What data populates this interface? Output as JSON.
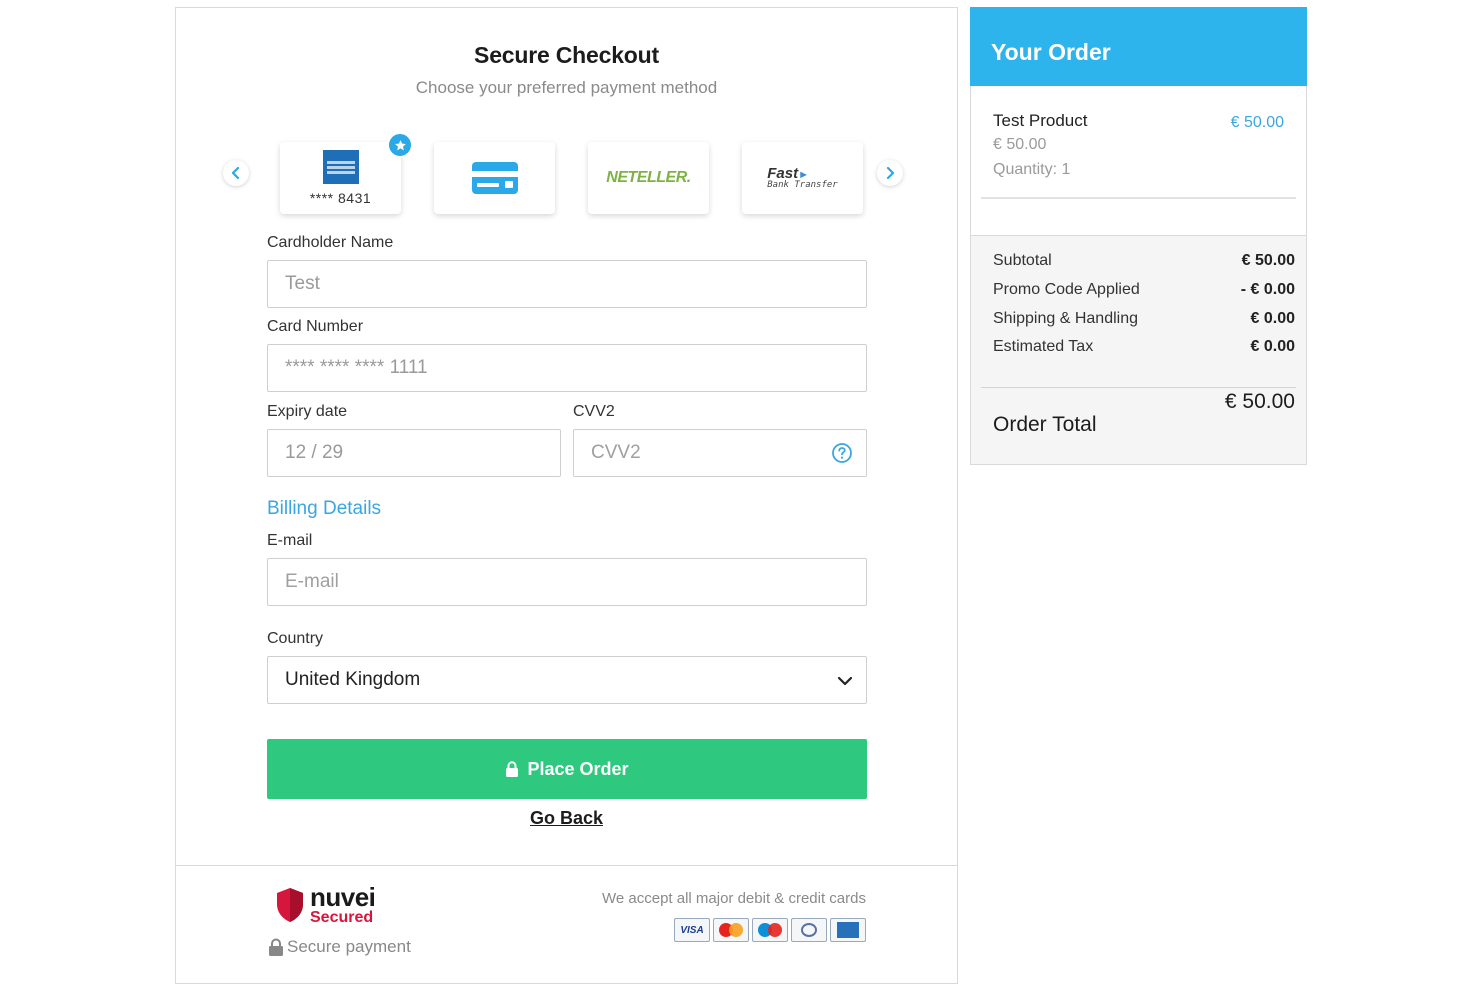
{
  "checkout": {
    "title": "Secure Checkout",
    "subtitle": "Choose your preferred payment method",
    "payment_methods": [
      {
        "name": "American Express",
        "masked": "**** 8431",
        "selected": true
      },
      {
        "name": "Credit Card"
      },
      {
        "name": "NETELLER",
        "logo_text": "NETELLER."
      },
      {
        "name": "Fast Bank Transfer",
        "logo_text": "Fast",
        "logo_subtext": "Bank Transfer"
      }
    ],
    "cardholder_label": "Cardholder Name",
    "cardholder_value": "Test",
    "card_number_label": "Card Number",
    "card_number_value": "**** **** **** 1111",
    "expiry_label": "Expiry date",
    "expiry_value": "12 / 29",
    "cvv_label": "CVV2",
    "cvv_placeholder": "CVV2",
    "billing_heading": "Billing Details",
    "email_label": "E-mail",
    "email_placeholder": "E-mail",
    "country_label": "Country",
    "country_value": "United Kingdom",
    "place_order_label": "Place Order",
    "go_back_label": "Go Back",
    "footer": {
      "brand_name": "nuvei",
      "brand_tag": "Secured",
      "secure_payment": "Secure payment",
      "accept_text": "We accept all major debit & credit cards",
      "card_brands": [
        "VISA",
        "Mastercard",
        "Maestro",
        "Diners Club",
        "American Express"
      ]
    }
  },
  "order": {
    "title": "Your Order",
    "product_name": "Test Product",
    "product_price": "€ 50.00",
    "product_unit_price": "€ 50.00",
    "product_quantity": "Quantity: 1",
    "subtotal_label": "Subtotal",
    "subtotal_value": "€ 50.00",
    "promo_label": "Promo Code Applied",
    "promo_value": "- € 0.00",
    "shipping_label": "Shipping & Handling",
    "shipping_value": "€ 0.00",
    "tax_label": "Estimated Tax",
    "tax_value": "€ 0.00",
    "total_label": "Order Total",
    "total_value": "€ 50.00"
  },
  "colors": {
    "accent_blue": "#2eb4ec",
    "link_blue": "#3aa6e0",
    "place_order_green": "#2ec97f",
    "nuvei_red": "#d6163c"
  },
  "icons": {
    "arrow_left": "chevron-left-icon",
    "arrow_right": "chevron-right-icon",
    "selected_badge": "star-icon",
    "cvv_help": "help-circle-icon",
    "country_dropdown": "chevron-down-icon",
    "place_order": "lock-icon",
    "secure_payment": "lock-icon",
    "nuvei": "shield-icon"
  }
}
